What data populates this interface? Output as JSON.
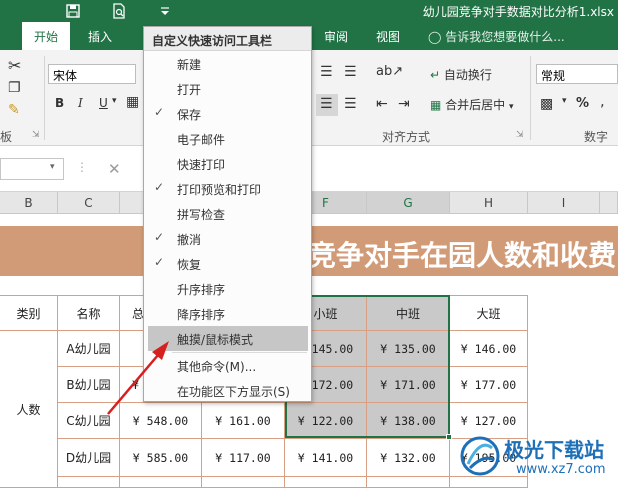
{
  "window": {
    "title": "幼儿园竞争对手数据对比分析1.xlsx"
  },
  "tabs": [
    {
      "label": "开始",
      "active": true
    },
    {
      "label": "插入"
    },
    {
      "label": "审阅"
    },
    {
      "label": "视图"
    }
  ],
  "tell_me": "告诉我您想要做什么...",
  "ribbon": {
    "font_name": "宋体",
    "bold": "B",
    "italic": "I",
    "underline": "U",
    "wrap_text": "自动换行",
    "merge_center": "合并后居中",
    "number_format": "常规",
    "percent": "%",
    "group_alignment": "对齐方式",
    "group_number": "数字",
    "group_left_fragment": "板"
  },
  "columns": [
    "B",
    "C",
    "F",
    "G",
    "H",
    "I"
  ],
  "banner": {
    "title_fragment": "竞争对手在园人数和收费"
  },
  "table": {
    "header": [
      "类别",
      "名称",
      "总",
      "小班",
      "中班",
      "大班"
    ],
    "category": "人数",
    "rows": [
      {
        "name": "A幼儿园",
        "c3": "",
        "c4": "",
        "small": "¥ 145.00",
        "middle": "¥ 135.00",
        "large": "¥ 146.00"
      },
      {
        "name": "B幼儿园",
        "c3": "¥",
        "c4": "",
        "small": "¥ 172.00",
        "middle": "¥ 171.00",
        "large": "¥ 177.00"
      },
      {
        "name": "C幼儿园",
        "c3": "¥ 548.00",
        "c4": "¥ 161.00",
        "small": "¥ 122.00",
        "middle": "¥ 138.00",
        "large": "¥ 127.00"
      },
      {
        "name": "D幼儿园",
        "c3": "¥ 585.00",
        "c4": "¥ 117.00",
        "small": "¥ 141.00",
        "middle": "¥ 132.00",
        "large": "¥ 195.00"
      }
    ]
  },
  "menu": {
    "title": "自定义快速访问工具栏",
    "items": [
      {
        "label": "新建",
        "checked": false
      },
      {
        "label": "打开",
        "checked": false
      },
      {
        "label": "保存",
        "checked": true
      },
      {
        "label": "电子邮件",
        "checked": false
      },
      {
        "label": "快速打印",
        "checked": false
      },
      {
        "label": "打印预览和打印",
        "checked": true
      },
      {
        "label": "拼写检查",
        "checked": false
      },
      {
        "label": "撤消",
        "checked": true
      },
      {
        "label": "恢复",
        "checked": true
      },
      {
        "label": "升序排序",
        "checked": false
      },
      {
        "label": "降序排序",
        "checked": false
      },
      {
        "label": "触摸/鼠标模式",
        "checked": false,
        "highlighted": true
      },
      {
        "label": "其他命令(M)...",
        "checked": false
      },
      {
        "label": "在功能区下方显示(S)",
        "checked": false
      }
    ],
    "check_mark": "✓"
  },
  "watermark": {
    "name": "极光下载站",
    "url": "www.xz7.com"
  },
  "colors": {
    "excel_green": "#217346",
    "banner": "#d29b78",
    "selection_fill": "#c9c9c9",
    "arrow": "#d62020"
  }
}
